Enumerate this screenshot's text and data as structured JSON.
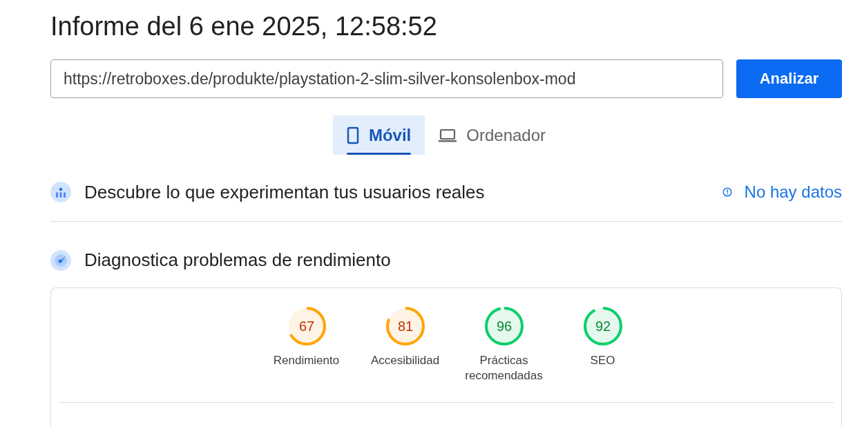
{
  "report_title": "Informe del 6 ene 2025, 12:58:52",
  "url_field": {
    "value": "https://retroboxes.de/produkte/playstation-2-slim-silver-konsolenbox-mod"
  },
  "analyze_button": "Analizar",
  "tabs": [
    {
      "label": "Móvil",
      "kind": "phone",
      "selected": true
    },
    {
      "label": "Ordenador",
      "kind": "laptop",
      "selected": false
    }
  ],
  "field_data": {
    "title": "Descubre lo que experimentan tus usuarios reales",
    "status": "No hay datos"
  },
  "diagnostics": {
    "title": "Diagnostica problemas de rendimiento",
    "gauges": [
      {
        "score": "67",
        "label": "Rendimiento"
      },
      {
        "score": "81",
        "label": "Accesibilidad"
      },
      {
        "score": "96",
        "label": "Prácticas recomendadas"
      },
      {
        "score": "92",
        "label": "SEO"
      }
    ]
  }
}
